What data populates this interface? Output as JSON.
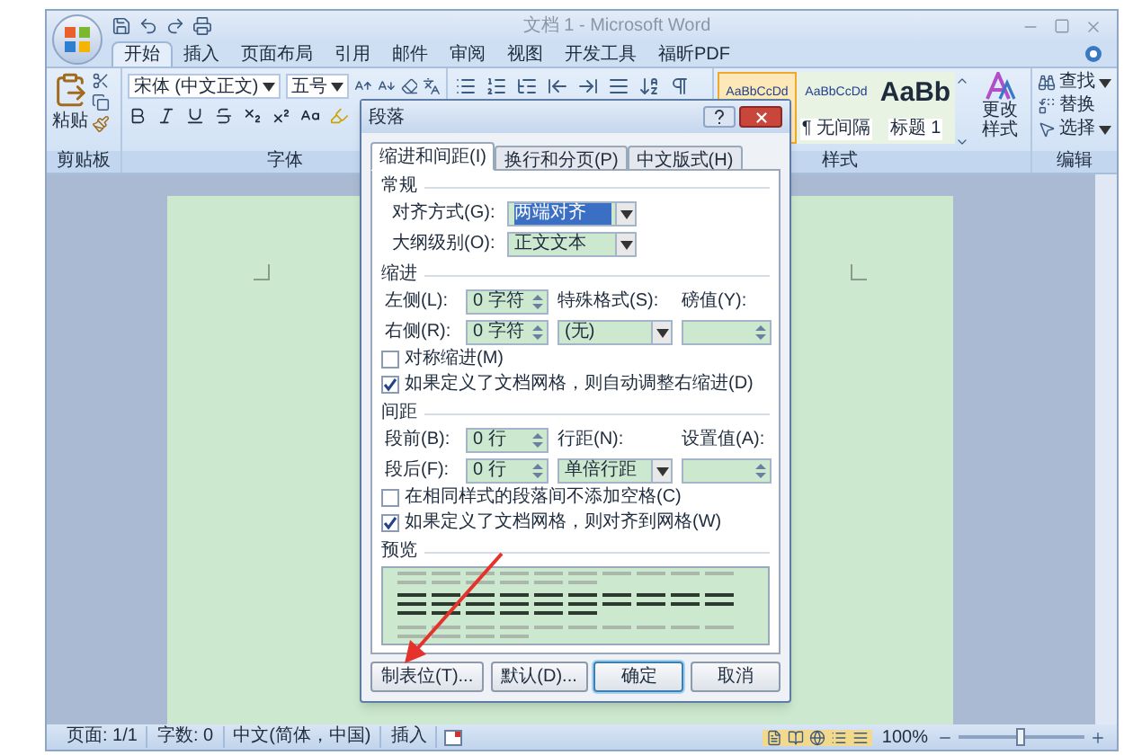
{
  "window": {
    "title": "文档 1 - Microsoft Word"
  },
  "ribbon": {
    "tabs": [
      {
        "label": "开始",
        "selected": true
      },
      {
        "label": "插入",
        "selected": false
      },
      {
        "label": "页面布局",
        "selected": false
      },
      {
        "label": "引用",
        "selected": false
      },
      {
        "label": "邮件",
        "selected": false
      },
      {
        "label": "审阅",
        "selected": false
      },
      {
        "label": "视图",
        "selected": false
      },
      {
        "label": "开发工具",
        "selected": false
      },
      {
        "label": "福昕PDF",
        "selected": false
      }
    ],
    "clipboard": {
      "paste": "粘贴",
      "label": "剪贴板"
    },
    "font": {
      "name": "宋体 (中文正文)",
      "size": "五号",
      "label": "字体"
    },
    "styles": {
      "items": [
        {
          "preview": "AaBbCcDd",
          "kind": "small",
          "selected": true
        },
        {
          "preview": "AaBbCcDd",
          "label": "¶ 无间隔",
          "kind": "small",
          "selected": false
        },
        {
          "preview": "AaBb",
          "label": "标题 1",
          "kind": "large",
          "selected": false
        }
      ],
      "change": "更改样式",
      "label": "样式"
    },
    "editing": {
      "items": [
        {
          "label": "查找",
          "kind": "menu"
        },
        {
          "label": "替换",
          "kind": "plain"
        },
        {
          "label": "选择",
          "kind": "menu"
        }
      ],
      "label": "编辑"
    }
  },
  "dialog": {
    "title": "段落",
    "tabs": [
      {
        "label": "缩进和间距(I)",
        "selected": true
      },
      {
        "label": "换行和分页(P)",
        "selected": false
      },
      {
        "label": "中文版式(H)",
        "selected": false
      }
    ],
    "general": {
      "heading": "常规",
      "alignment": {
        "label": "对齐方式(G):",
        "value": "两端对齐"
      },
      "outline": {
        "label": "大纲级别(O):",
        "value": "正文文本"
      }
    },
    "indent": {
      "heading": "缩进",
      "left": {
        "label": "左侧(L):",
        "value": "0 字符"
      },
      "right": {
        "label": "右侧(R):",
        "value": "0 字符"
      },
      "special": {
        "label": "特殊格式(S):",
        "value": "(无)"
      },
      "by": {
        "label": "磅值(Y):"
      },
      "checks": [
        {
          "label": "对称缩进(M)",
          "checked": false
        },
        {
          "label": "如果定义了文档网格，则自动调整右缩进(D)",
          "checked": true
        }
      ]
    },
    "spacing": {
      "heading": "间距",
      "before": {
        "label": "段前(B):",
        "value": "0 行"
      },
      "after": {
        "label": "段后(F):",
        "value": "0 行"
      },
      "line": {
        "label": "行距(N):",
        "value": "单倍行距"
      },
      "at": {
        "label": "设置值(A):"
      },
      "checks": [
        {
          "label": "在相同样式的段落间不添加空格(C)",
          "checked": false
        },
        {
          "label": "如果定义了文档网格，则对齐到网格(W)",
          "checked": true
        }
      ]
    },
    "preview": {
      "heading": "预览"
    },
    "buttons": [
      {
        "label": "制表位(T)...",
        "kind": "normal"
      },
      {
        "label": "默认(D)...",
        "kind": "normal"
      },
      {
        "label": "确定",
        "kind": "default"
      },
      {
        "label": "取消",
        "kind": "normal"
      }
    ]
  },
  "status_bar": {
    "items": [
      "页面: 1/1",
      "字数: 0",
      "中文(简体，中国)",
      "插入"
    ],
    "zoom": {
      "reading": "100%",
      "level": 0.5
    }
  }
}
